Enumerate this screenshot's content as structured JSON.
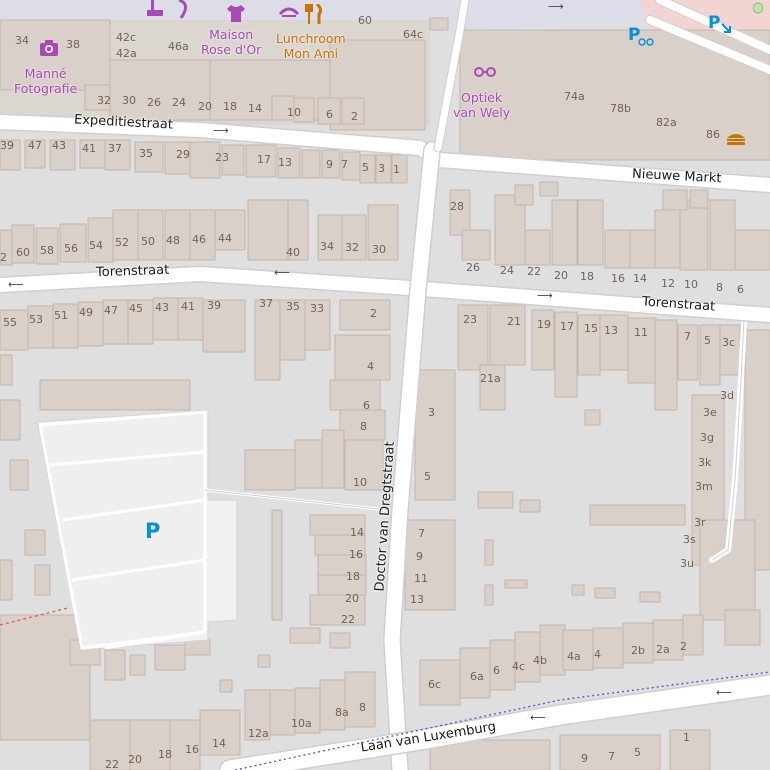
{
  "map": {
    "streets": {
      "expeditiestraat": "Expeditiestraat",
      "nieuwe_markt": "Nieuwe Markt",
      "torenstraat_west": "Torenstraat",
      "torenstraat_east": "Torenstraat",
      "doctor_van_dregtstraat": "Doctor van Dregtstraat",
      "laan_van_luxemburg": "Laan van Luxemburg"
    },
    "pois": {
      "manne_fotografie": "Manné\nFotografie",
      "maison_rose_dor": "Maison\nRose d'Or",
      "lunchroom_mon_ami": "Lunchroom\nMon Ami",
      "optiek_van_wely": "Optiek\nvan Wely"
    },
    "parking_symbol": "P",
    "house_numbers": [
      "34",
      "38",
      "42c",
      "42a",
      "46a",
      "60",
      "64c",
      "32",
      "30",
      "26",
      "24",
      "20",
      "18",
      "14",
      "10",
      "6",
      "2",
      "74a",
      "78b",
      "82a",
      "86",
      "39",
      "47",
      "43",
      "41",
      "37",
      "35",
      "29",
      "23",
      "17",
      "13",
      "9",
      "7",
      "5",
      "3",
      "1",
      "28",
      "2",
      "60",
      "58",
      "56",
      "54",
      "52",
      "50",
      "48",
      "46",
      "44",
      "40",
      "34",
      "32",
      "30",
      "26",
      "24",
      "22",
      "20",
      "18",
      "16",
      "14",
      "12",
      "10",
      "8",
      "6",
      "55",
      "53",
      "51",
      "49",
      "47",
      "45",
      "43",
      "41",
      "39",
      "37",
      "35",
      "33",
      "2",
      "23",
      "21",
      "19",
      "17",
      "15",
      "13",
      "11",
      "7",
      "5",
      "3c",
      "4",
      "21a",
      "3d",
      "6",
      "3",
      "3e",
      "8",
      "3g",
      "3k",
      "10",
      "5",
      "3m",
      "14",
      "7",
      "3r",
      "16",
      "9",
      "3s",
      "18",
      "11",
      "3u",
      "20",
      "13",
      "22",
      "6c",
      "6a",
      "6",
      "4c",
      "4b",
      "4a",
      "4",
      "2b",
      "2a",
      "2",
      "12a",
      "10a",
      "8a",
      "8",
      "22",
      "20",
      "18",
      "16",
      "14",
      "1",
      "9",
      "7",
      "5"
    ]
  }
}
